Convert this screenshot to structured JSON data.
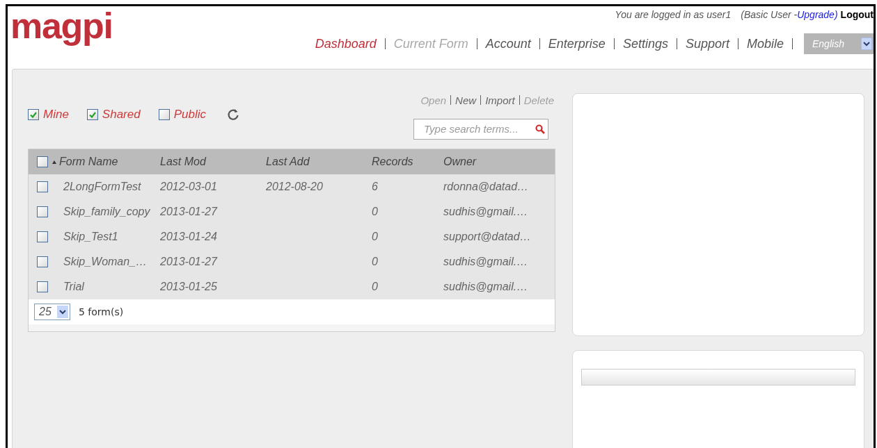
{
  "logo": "magpi",
  "user_bar": {
    "prefix": "You are logged in as",
    "user": "user1",
    "plan": "(Basic User -",
    "upgrade": "Upgrade)",
    "logout": "Logout"
  },
  "nav": [
    {
      "label": "Dashboard",
      "selected": true,
      "disabled": false
    },
    {
      "label": "Current Form",
      "selected": false,
      "disabled": true
    },
    {
      "label": "Account",
      "selected": false,
      "disabled": false
    },
    {
      "label": "Enterprise",
      "selected": false,
      "disabled": false
    },
    {
      "label": "Settings",
      "selected": false,
      "disabled": false
    },
    {
      "label": "Support",
      "selected": false,
      "disabled": false
    },
    {
      "label": "Mobile",
      "selected": false,
      "disabled": false
    }
  ],
  "language": {
    "value": "English"
  },
  "filters": [
    {
      "label": "Mine",
      "checked": true
    },
    {
      "label": "Shared",
      "checked": true
    },
    {
      "label": "Public",
      "checked": false
    }
  ],
  "actions": [
    {
      "label": "Open",
      "disabled": true
    },
    {
      "label": "New",
      "disabled": false
    },
    {
      "label": "Import",
      "disabled": false
    },
    {
      "label": "Delete",
      "disabled": true
    }
  ],
  "search": {
    "placeholder": "Type search terms..."
  },
  "table": {
    "select_all_checked": false,
    "columns": [
      "Form Name",
      "Last Mod",
      "Last Add",
      "Records",
      "Owner"
    ],
    "rows": [
      {
        "checked": false,
        "cells": [
          "2LongFormTest",
          "2012-03-01",
          "2012-08-20",
          "6",
          "rdonna@datad…"
        ]
      },
      {
        "checked": false,
        "cells": [
          "Skip_family_copy",
          "2013-01-27",
          "",
          "0",
          "sudhis@gmail.…"
        ]
      },
      {
        "checked": false,
        "cells": [
          "Skip_Test1",
          "2013-01-24",
          "",
          "0",
          "support@datad…"
        ]
      },
      {
        "checked": false,
        "cells": [
          "Skip_Woman_…",
          "2013-01-27",
          "",
          "0",
          "sudhis@gmail.…"
        ]
      },
      {
        "checked": false,
        "cells": [
          "Trial",
          "2013-01-25",
          "",
          "0",
          "sudhis@gmail.…"
        ]
      }
    ]
  },
  "pager": {
    "page_size": "25",
    "count": "5 form(s)"
  }
}
